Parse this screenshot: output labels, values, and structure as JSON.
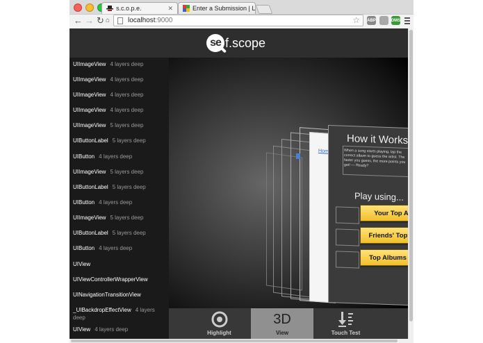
{
  "browser": {
    "tabs": [
      {
        "title": "s.c.o.p.e.",
        "active": true
      },
      {
        "title": "Enter a Submission | LA H",
        "active": false
      }
    ],
    "url_host": "localhost",
    "url_port": ":9000",
    "extensions": [
      "ABP",
      "DMS"
    ]
  },
  "app": {
    "logo_prefix": "se",
    "logo_rest": "f.scope",
    "sidebar": {
      "items": [
        {
          "name": "UIImageView",
          "depth": "4 layers deep"
        },
        {
          "name": "UIImageView",
          "depth": "4 layers deep"
        },
        {
          "name": "UIImageView",
          "depth": "4 layers deep"
        },
        {
          "name": "UIImageView",
          "depth": "4 layers deep"
        },
        {
          "name": "UIImageView",
          "depth": "5 layers deep"
        },
        {
          "name": "UIButtonLabel",
          "depth": "5 layers deep"
        },
        {
          "name": "UIButton",
          "depth": "4 layers deep"
        },
        {
          "name": "UIImageView",
          "depth": "5 layers deep"
        },
        {
          "name": "UIButtonLabel",
          "depth": "5 layers deep"
        },
        {
          "name": "UIButton",
          "depth": "4 layers deep"
        },
        {
          "name": "UIImageView",
          "depth": "5 layers deep"
        },
        {
          "name": "UIButtonLabel",
          "depth": "5 layers deep"
        },
        {
          "name": "UIButton",
          "depth": "4 layers deep"
        },
        {
          "name": "UIView",
          "depth": ""
        },
        {
          "name": "UIViewControllerWrapperView",
          "depth": ""
        },
        {
          "name": "UINavigationTransitionView",
          "depth": ""
        },
        {
          "name": "_UIBackdropEffectView",
          "depth": "4 layers deep"
        },
        {
          "name": "UIView",
          "depth": "4 layers deep"
        }
      ]
    },
    "preview": {
      "title": "How it Works:",
      "description": "When a song starts playing, tap the correct album to guess the artist. The faster you guess, the more points you get! — Ready?",
      "play_label": "Play using...",
      "back_label": "Hom",
      "options": [
        "Your Top Albums",
        "Friends' Top Albums",
        "Top Albums on Rdio"
      ],
      "button_color": "#f5c62e"
    },
    "toolbar": {
      "highlight_label": "Highlight",
      "view_big": "3D",
      "view_label": "View",
      "touch_label": "Touch Test",
      "active": "View"
    }
  }
}
